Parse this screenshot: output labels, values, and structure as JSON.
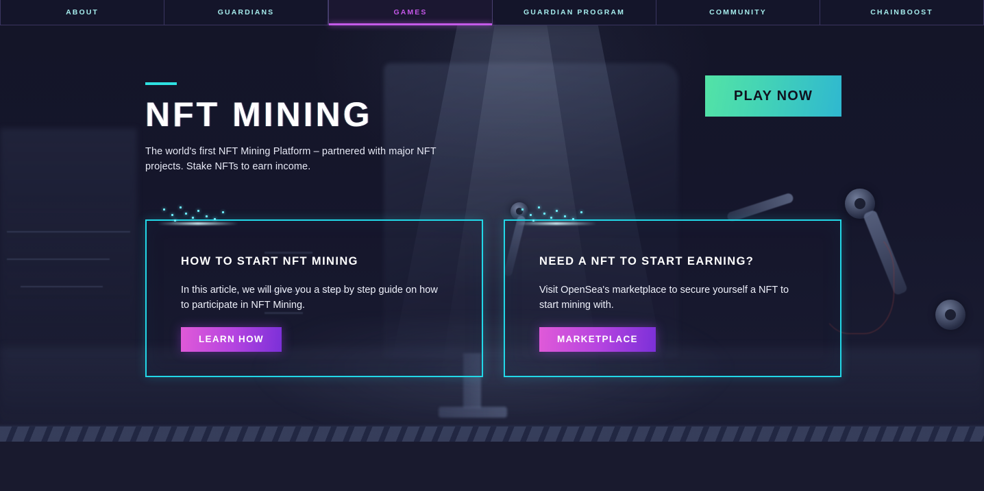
{
  "colors": {
    "page_bg": "#191a2e",
    "nav_bg": "#14152a",
    "nav_text": "#a5ecec",
    "nav_active_text": "#c457e8",
    "nav_active_underline": "#c45ae8",
    "accent_cyan": "#2ee0e0",
    "card_border": "#22d8e8",
    "play_gradient_start": "#53e3a6",
    "play_gradient_end": "#2fb8d0",
    "card_btn_gradient_start": "#e05ad8",
    "card_btn_gradient_end": "#7b30d8",
    "body_text": "#eef0fa"
  },
  "nav": {
    "items": [
      {
        "label": "ABOUT",
        "active": false
      },
      {
        "label": "GUARDIANS",
        "active": false
      },
      {
        "label": "GAMES",
        "active": true
      },
      {
        "label": "GUARDIAN PROGRAM",
        "active": false
      },
      {
        "label": "COMMUNITY",
        "active": false
      },
      {
        "label": "CHAINBOOST",
        "active": false
      }
    ]
  },
  "hero": {
    "title": "NFT MINING",
    "subtitle": "The world's first NFT Mining Platform – partnered with major NFT projects. Stake NFTs to earn income.",
    "play_button": "PLAY NOW"
  },
  "cards": [
    {
      "title": "HOW TO START NFT MINING",
      "body": "In this article, we will give you a step by step guide on how to participate in NFT Mining.",
      "button": "LEARN HOW"
    },
    {
      "title": "NEED A NFT TO START EARNING?",
      "body": "Visit OpenSea's marketplace to secure yourself a NFT to start mining with.",
      "button": "MARKETPLACE"
    }
  ]
}
